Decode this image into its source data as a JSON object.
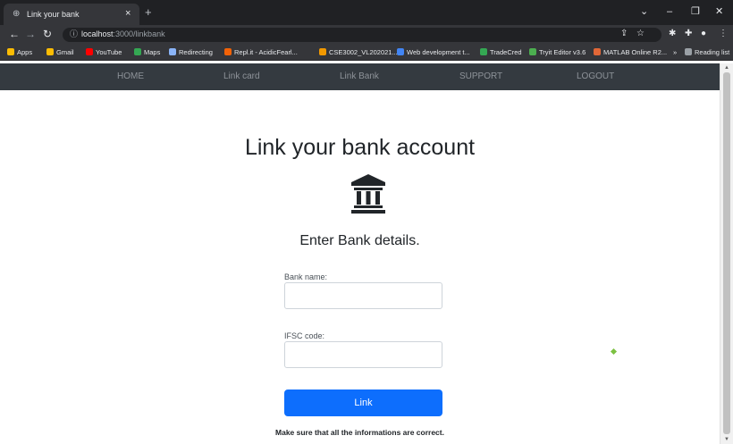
{
  "browser": {
    "tab_title": "Link your bank",
    "tab_close": "×",
    "new_tab": "+",
    "url_host": "localhost",
    "url_path": ":3000/linkbank",
    "bookmarks": [
      {
        "label": "Apps",
        "color": "#e8eaed"
      },
      {
        "label": "Gmail",
        "color": "#fbbc04"
      },
      {
        "label": "YouTube",
        "color": "#ff0000"
      },
      {
        "label": "Maps",
        "color": "#34a853"
      },
      {
        "label": "Redirecting",
        "color": "#8ab4f8"
      },
      {
        "label": "Repl.it - AcidicFearl...",
        "color": "#f26207"
      },
      {
        "label": "CSE3002_VL202021...",
        "color": "#f29900"
      },
      {
        "label": "Web development t...",
        "color": "#4285f4"
      },
      {
        "label": "TradeCred",
        "color": "#34a853"
      },
      {
        "label": "Tryit Editor v3.6",
        "color": "#4caf50"
      },
      {
        "label": "MATLAB Online R2...",
        "color": "#e16737"
      }
    ],
    "bookmarks_more": "»",
    "reading_list": "Reading list"
  },
  "nav": {
    "home": "HOME",
    "link_card": "Link card",
    "link_bank": "Link Bank",
    "support": "SUPPORT",
    "logout": "LOGOUT"
  },
  "page": {
    "title": "Link your bank account",
    "subheading": "Enter Bank details.",
    "bank_name_label": "Bank name:",
    "bank_name_value": "",
    "ifsc_label": "IFSC code:",
    "ifsc_value": "",
    "submit_label": "Link",
    "note": "Make sure that all the informations are correct."
  },
  "colors": {
    "nav_bg": "#343a40",
    "primary": "#0d6efd",
    "accent_dot": "#7cc142"
  }
}
